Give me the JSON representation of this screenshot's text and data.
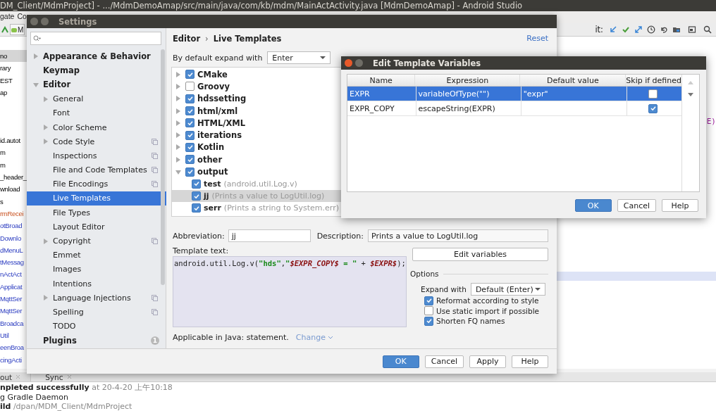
{
  "ide": {
    "title_bar": "DM_Client/MdmProject] - .../MdmDemoAmap/src/main/java/com/kb/mdm/MainActActivity.java [MdmDemoAmap] - Android Studio",
    "menu": [
      "gate",
      "Co"
    ],
    "run_config": "M",
    "toolbar_label": "it:",
    "project_items": [
      {
        "label": "no",
        "kind": "plain",
        "selected": true
      },
      {
        "label": "rary",
        "kind": "plain",
        "selected": false
      },
      {
        "label": "EST",
        "kind": "plain",
        "selected": false
      },
      {
        "label": "ap",
        "kind": "plain",
        "selected": false
      },
      {
        "label": "id.autot",
        "kind": "plain",
        "selected": false
      },
      {
        "label": "m",
        "kind": "plain",
        "selected": false
      },
      {
        "label": "m",
        "kind": "plain",
        "selected": false
      },
      {
        "label": "_header_",
        "kind": "plain",
        "selected": false
      },
      {
        "label": "wnload",
        "kind": "plain",
        "selected": false
      },
      {
        "label": "s",
        "kind": "plain",
        "selected": false
      },
      {
        "label": "rmRecei",
        "kind": "unversioned",
        "selected": false
      },
      {
        "label": "otBroad",
        "kind": "modified",
        "selected": false
      },
      {
        "label": "Downlo",
        "kind": "modified",
        "selected": false
      },
      {
        "label": "dMenuL",
        "kind": "modified",
        "selected": false
      },
      {
        "label": "tMessag",
        "kind": "modified",
        "selected": false
      },
      {
        "label": "nActAct",
        "kind": "modified",
        "selected": false
      },
      {
        "label": "Applicat",
        "kind": "modified",
        "selected": false
      },
      {
        "label": "MqttSer",
        "kind": "modified",
        "selected": false
      },
      {
        "label": "MqttSer",
        "kind": "modified",
        "selected": false
      },
      {
        "label": "Broadca",
        "kind": "modified",
        "selected": false
      },
      {
        "label": "Util",
        "kind": "modified",
        "selected": false
      },
      {
        "label": "eenBroa",
        "kind": "modified",
        "selected": false
      },
      {
        "label": "cingActi",
        "kind": "modified",
        "selected": false
      }
    ],
    "editor_fragment": "E)",
    "bottom_tabs": [
      {
        "label": "out",
        "selected": false
      },
      {
        "label": "Sync",
        "selected": true
      }
    ],
    "log": [
      [
        {
          "kind": "strong",
          "text": "npleted successfully"
        },
        {
          "kind": "muted",
          "text": " at 20-4-20 上午10:18"
        }
      ],
      [
        {
          "kind": "plain",
          "text": "g Gradle Daemon"
        }
      ],
      [
        {
          "kind": "strong",
          "text": "ild"
        },
        {
          "kind": "muted",
          "text": " /dpan/MDM_Client/MdmProject"
        }
      ]
    ]
  },
  "settings": {
    "title": "Settings",
    "sidebar": [
      {
        "label": "Appearance & Behavior",
        "expanded": false,
        "selected": false
      },
      {
        "label": "Keymap",
        "selected": false
      },
      {
        "label": "Editor",
        "expanded": true,
        "selected": false,
        "children": [
          {
            "label": "General",
            "expanded": false,
            "project_icon": false,
            "selected": false
          },
          {
            "label": "Font",
            "project_icon": false,
            "selected": false
          },
          {
            "label": "Color Scheme",
            "expanded": false,
            "project_icon": false,
            "selected": false
          },
          {
            "label": "Code Style",
            "expanded": false,
            "project_icon": true,
            "selected": false
          },
          {
            "label": "Inspections",
            "project_icon": true,
            "selected": false
          },
          {
            "label": "File and Code Templates",
            "project_icon": true,
            "selected": false
          },
          {
            "label": "File Encodings",
            "project_icon": true,
            "selected": false
          },
          {
            "label": "Live Templates",
            "project_icon": false,
            "selected": true
          },
          {
            "label": "File Types",
            "project_icon": false,
            "selected": false
          },
          {
            "label": "Layout Editor",
            "project_icon": false,
            "selected": false
          },
          {
            "label": "Copyright",
            "expanded": false,
            "project_icon": true,
            "selected": false
          },
          {
            "label": "Emmet",
            "project_icon": false,
            "selected": false
          },
          {
            "label": "Images",
            "project_icon": false,
            "selected": false
          },
          {
            "label": "Intentions",
            "project_icon": false,
            "selected": false
          },
          {
            "label": "Language Injections",
            "expanded": false,
            "project_icon": true,
            "selected": false
          },
          {
            "label": "Spelling",
            "project_icon": true,
            "selected": false
          },
          {
            "label": "TODO",
            "project_icon": false,
            "selected": false
          }
        ]
      },
      {
        "label": "Plugins",
        "selected": false,
        "badge": "1"
      }
    ],
    "breadcrumb": [
      "Editor",
      "›",
      "Live Templates"
    ],
    "reset": "Reset",
    "expand_label": "By default expand with",
    "expand_value": "Enter",
    "groups": [
      {
        "name": "CMake",
        "checked": true,
        "expanded": false
      },
      {
        "name": "Groovy",
        "checked": false,
        "expanded": false
      },
      {
        "name": "hdssetting",
        "checked": true,
        "expanded": false
      },
      {
        "name": "html/xml",
        "checked": true,
        "expanded": false
      },
      {
        "name": "HTML/XML",
        "checked": true,
        "expanded": false
      },
      {
        "name": "iterations",
        "checked": true,
        "expanded": false
      },
      {
        "name": "Kotlin",
        "checked": true,
        "expanded": false
      },
      {
        "name": "other",
        "checked": true,
        "expanded": false
      },
      {
        "name": "output",
        "checked": true,
        "expanded": true,
        "templates": [
          {
            "abbr": "test",
            "description": "(android.util.Log.v)",
            "checked": true,
            "selected": false
          },
          {
            "abbr": "jj",
            "description": "(Prints a value to LogUtil.log)",
            "checked": true,
            "selected": true
          },
          {
            "abbr": "serr",
            "description": "(Prints a string to System.err)",
            "checked": true,
            "selected": false
          }
        ]
      }
    ],
    "abbreviation_label": "Abbreviation:",
    "abbreviation": "jj",
    "description_label": "Description:",
    "description": "Prints a value to LogUtil.log",
    "template_text_label": "Template text:",
    "template_code": [
      {
        "kind": "plain",
        "text": "android.util.Log.v("
      },
      {
        "kind": "string",
        "text": "\"hds\""
      },
      {
        "kind": "plain",
        "text": ","
      },
      {
        "kind": "string",
        "text": "\""
      },
      {
        "kind": "variable",
        "text": "$EXPR_COPY$"
      },
      {
        "kind": "string",
        "text": " = \""
      },
      {
        "kind": "plain",
        "text": " + "
      },
      {
        "kind": "variable",
        "text": "$EXPR$"
      },
      {
        "kind": "plain",
        "text": ");"
      }
    ],
    "applicable": "Applicable in Java: statement.",
    "change_link": "Change",
    "edit_variables": "Edit variables",
    "options_title": "Options",
    "expand_with_label": "Expand with",
    "expand_with_value": "Default (Enter)",
    "options": [
      {
        "label": "Reformat according to style",
        "checked": true
      },
      {
        "label": "Use static import if possible",
        "checked": false
      },
      {
        "label": "Shorten FQ names",
        "checked": true
      }
    ],
    "buttons": [
      {
        "label": "OK",
        "primary": true
      },
      {
        "label": "Cancel",
        "primary": false
      },
      {
        "label": "Apply",
        "primary": false
      },
      {
        "label": "Help",
        "primary": false
      }
    ]
  },
  "variables_dialog": {
    "title": "Edit Template Variables",
    "columns": [
      "Name",
      "Expression",
      "Default value",
      "Skip if defined"
    ],
    "rows": [
      {
        "name": "EXPR",
        "expression": "variableOfType(\"\")",
        "default_value": "\"expr\"",
        "skip_if_defined": false,
        "selected": true
      },
      {
        "name": "EXPR_COPY",
        "expression": "escapeString(EXPR)",
        "skip_if_defined": true,
        "selected": false
      }
    ],
    "buttons": [
      {
        "label": "OK",
        "primary": true
      },
      {
        "label": "Cancel",
        "primary": false
      },
      {
        "label": "Help",
        "primary": false
      }
    ]
  }
}
